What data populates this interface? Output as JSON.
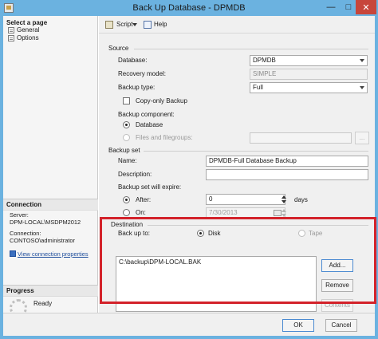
{
  "window": {
    "title": "Back Up Database - DPMDB",
    "controls": {
      "minimize": "—",
      "maximize": "□",
      "close": "✕"
    }
  },
  "left_pane": {
    "select_page_header": "Select a page",
    "pages": [
      {
        "label": "General",
        "icon": "page-icon",
        "selected": true
      },
      {
        "label": "Options",
        "icon": "page-icon",
        "selected": false
      }
    ],
    "connection": {
      "header": "Connection",
      "server_label": "Server:",
      "server_value": "DPM-LOCAL\\MSDPM2012",
      "connection_label": "Connection:",
      "connection_value": "CONTOSO\\administrator",
      "view_link": "View connection properties"
    },
    "progress": {
      "header": "Progress",
      "status": "Ready"
    }
  },
  "toolbar": {
    "script_label": "Script",
    "help_label": "Help"
  },
  "source": {
    "section_title": "Source",
    "database_label": "Database:",
    "database_value": "DPMDB",
    "recovery_label": "Recovery model:",
    "recovery_value": "SIMPLE",
    "backup_type_label": "Backup type:",
    "backup_type_value": "Full",
    "copy_only_label": "Copy-only Backup",
    "copy_only_checked": false,
    "component_label": "Backup component:",
    "component_database_label": "Database",
    "component_files_label": "Files and filegroups:",
    "component_selected": "Database",
    "files_button": "..."
  },
  "backup_set": {
    "section_title": "Backup set",
    "name_label": "Name:",
    "name_value": "DPMDB-Full Database Backup",
    "description_label": "Description:",
    "description_value": "",
    "expire_label": "Backup set will expire:",
    "after_label": "After:",
    "after_value": "0",
    "days_label": "days",
    "on_label": "On:",
    "on_value": "7/30/2013",
    "expire_selected": "After"
  },
  "destination": {
    "section_title": "Destination",
    "backup_to_label": "Back up to:",
    "disk_label": "Disk",
    "tape_label": "Tape",
    "selected": "Disk",
    "paths": [
      "C:\\backup\\DPM-LOCAL.BAK"
    ],
    "add_button": "Add...",
    "remove_button": "Remove",
    "contents_button": "Contents"
  },
  "footer": {
    "ok_button": "OK",
    "cancel_button": "Cancel"
  },
  "colors": {
    "titlebar": "#6bb2e0",
    "close_button": "#c7463b",
    "highlight_box": "#d3222a",
    "link": "#1f4e9c"
  }
}
